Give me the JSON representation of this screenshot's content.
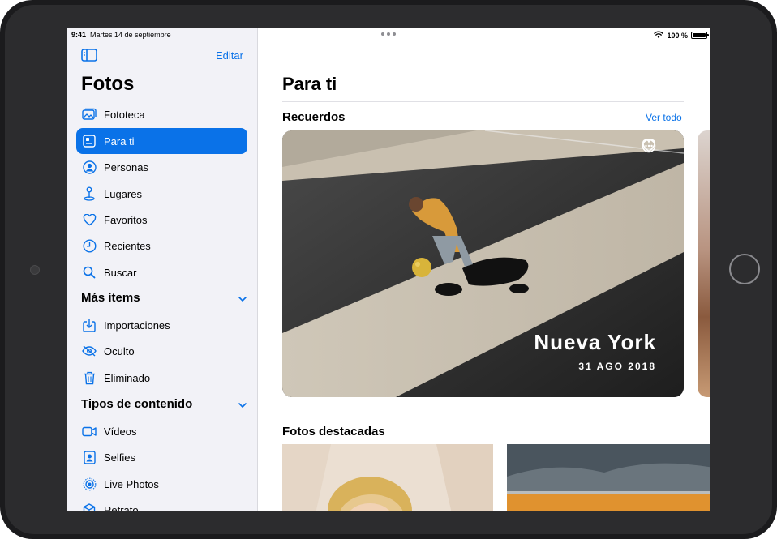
{
  "status_bar": {
    "time": "9:41",
    "date": "Martes 14 de septiembre",
    "battery": "100 %"
  },
  "sidebar": {
    "edit_label": "Editar",
    "title": "Fotos",
    "items": [
      {
        "label": "Fototeca",
        "icon": "photo-library-icon"
      },
      {
        "label": "Para ti",
        "icon": "for-you-icon",
        "selected": true
      },
      {
        "label": "Personas",
        "icon": "person-circle-icon"
      },
      {
        "label": "Lugares",
        "icon": "map-pin-icon"
      },
      {
        "label": "Favoritos",
        "icon": "heart-icon"
      },
      {
        "label": "Recientes",
        "icon": "clock-icon"
      },
      {
        "label": "Buscar",
        "icon": "search-icon"
      }
    ],
    "sections": [
      {
        "label": "Más ítems",
        "items": [
          {
            "label": "Importaciones",
            "icon": "import-icon"
          },
          {
            "label": "Oculto",
            "icon": "eye-slash-icon"
          },
          {
            "label": "Eliminado",
            "icon": "trash-icon"
          }
        ]
      },
      {
        "label": "Tipos de contenido",
        "items": [
          {
            "label": "Vídeos",
            "icon": "video-icon"
          },
          {
            "label": "Selfies",
            "icon": "selfie-icon"
          },
          {
            "label": "Live Photos",
            "icon": "live-photo-icon"
          },
          {
            "label": "Retrato",
            "icon": "cube-icon"
          }
        ]
      }
    ]
  },
  "main": {
    "title": "Para ti",
    "memories": {
      "section_title": "Recuerdos",
      "see_all": "Ver todo",
      "card": {
        "title": "Nueva York",
        "date": "31 AGO 2018"
      }
    },
    "featured": {
      "section_title": "Fotos destacadas"
    }
  },
  "colors": {
    "accent": "#0a72e8",
    "sidebar_bg": "#f2f2f7",
    "device_frame": "#1b1b1d"
  }
}
